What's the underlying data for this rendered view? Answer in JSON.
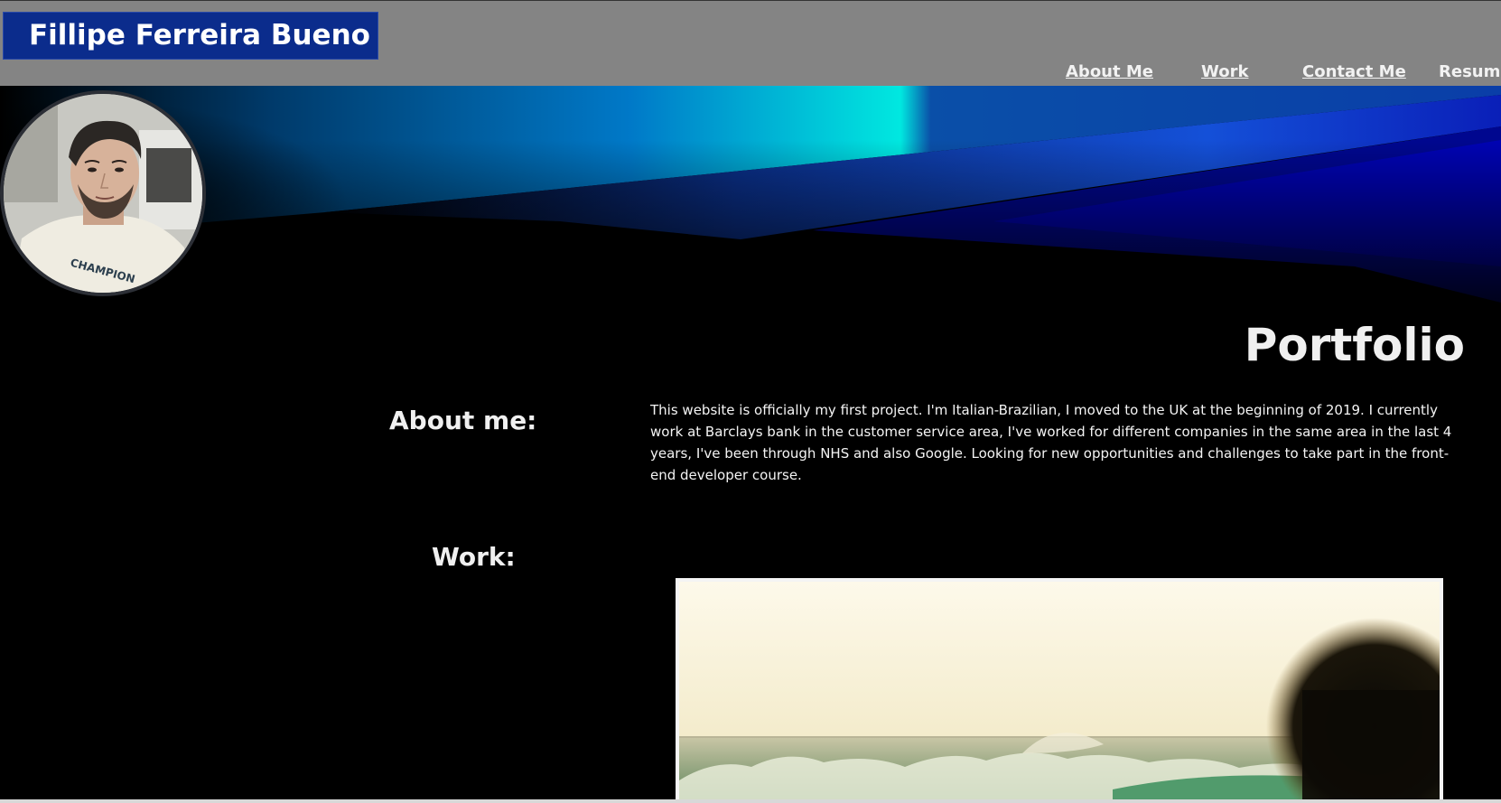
{
  "header": {
    "brand": "Fillipe Ferreira Bueno",
    "nav": [
      {
        "label": "About Me"
      },
      {
        "label": "Work"
      },
      {
        "label": "Contact Me"
      },
      {
        "label": "Resume"
      }
    ]
  },
  "main": {
    "title": "Portfolio",
    "about": {
      "heading": "About me:",
      "text": "This website is officially my first project. I'm Italian-Brazilian, I moved to the UK at the beginning of 2019. I currently work at Barclays bank in the customer service area, I've worked for different companies in the same area in the last 4 years, I've been through NHS and also Google. Looking for new opportunities and challenges to take part in the front-end developer course."
    },
    "work": {
      "heading": "Work:"
    }
  },
  "colors": {
    "header_bg": "#848484",
    "brand_bg": "#0b2c8c",
    "page_bg": "#000000",
    "accent_cyan": "#00e5e0",
    "accent_blue": "#0026d6"
  },
  "icons": {
    "avatar": "profile-photo",
    "work_image": "surf-wave-photo"
  }
}
